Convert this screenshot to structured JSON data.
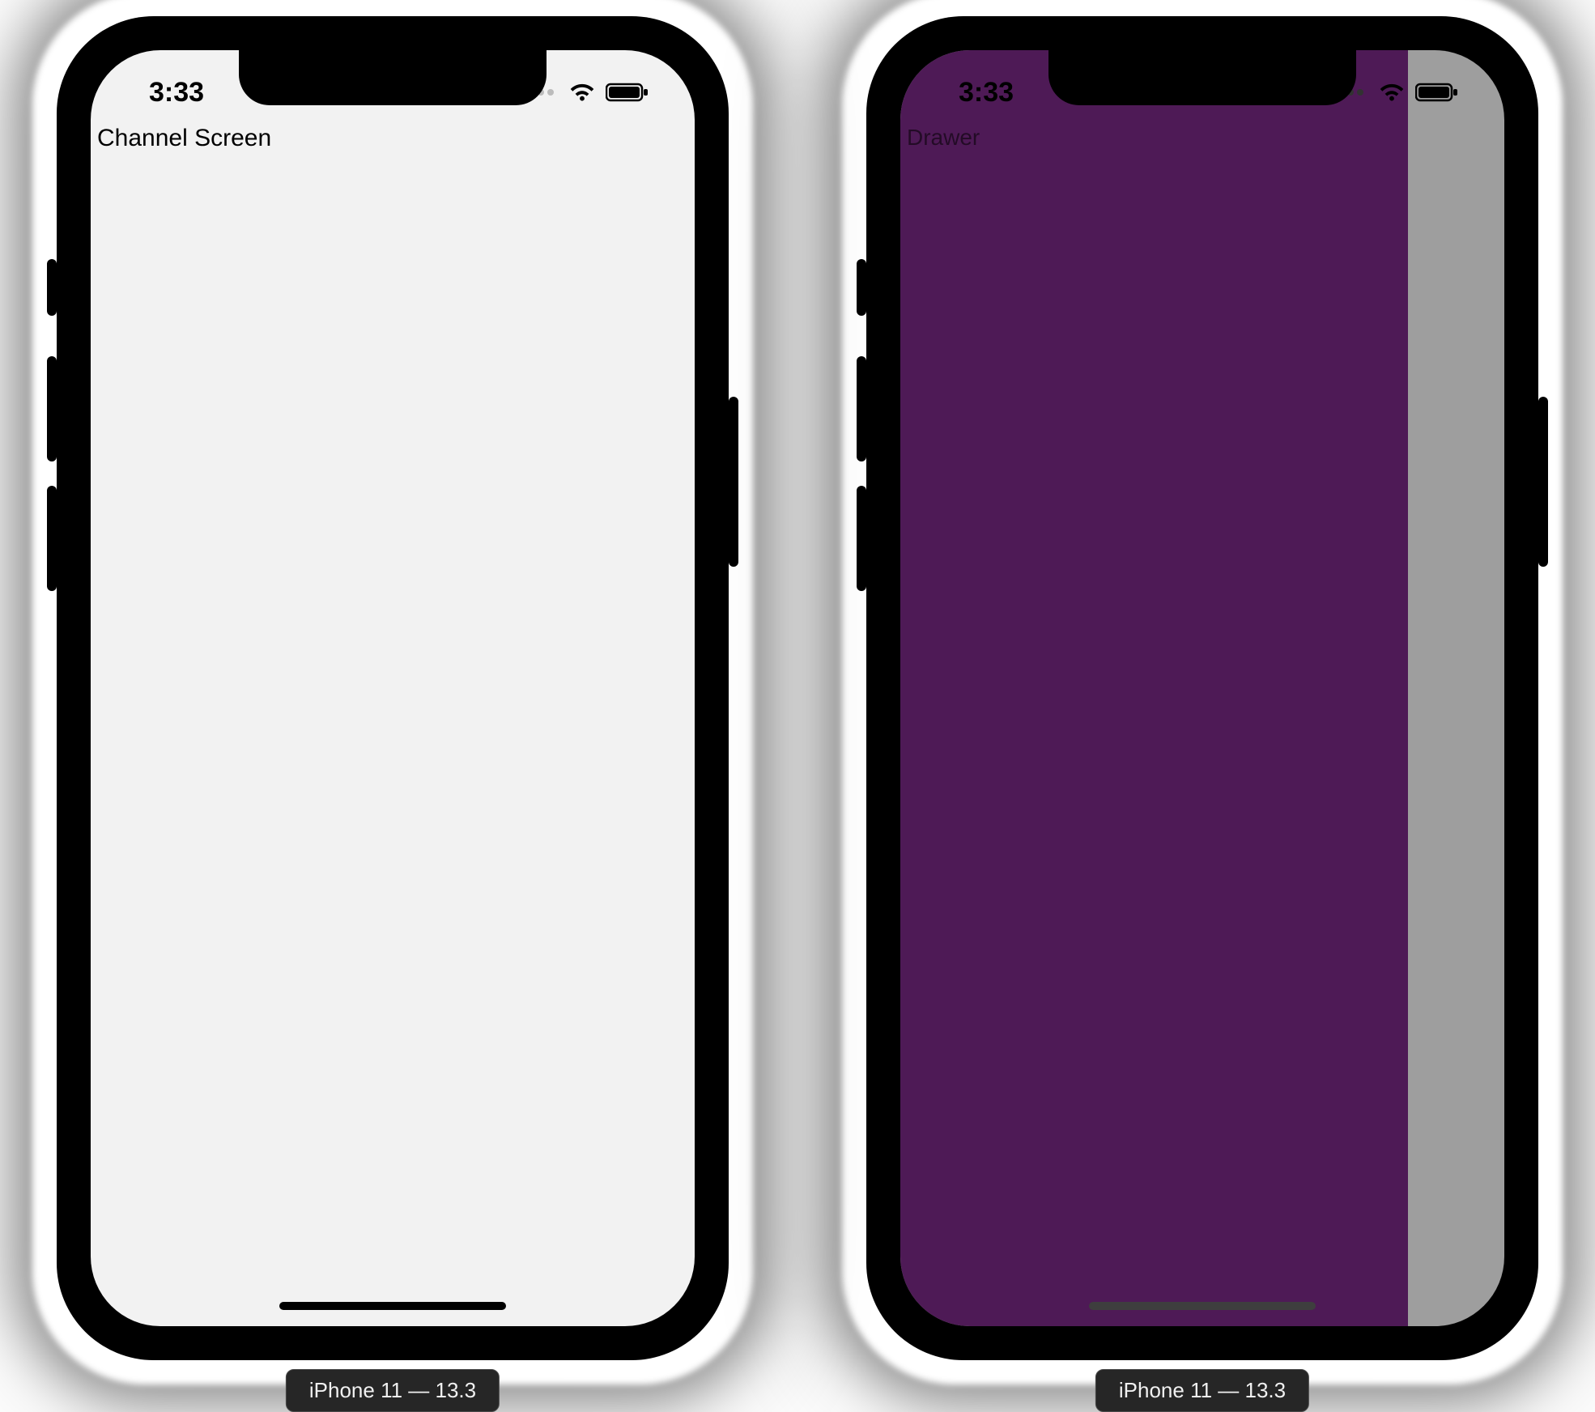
{
  "device_label": "iPhone 11 — 13.3",
  "status": {
    "time": "3:33"
  },
  "left": {
    "title": "Channel Screen"
  },
  "right": {
    "title": "Drawer"
  },
  "colors": {
    "drawer_bg": "#4e1a56",
    "overlay_bg": "#9e9e9e",
    "screen_bg": "#f2f2f2"
  }
}
